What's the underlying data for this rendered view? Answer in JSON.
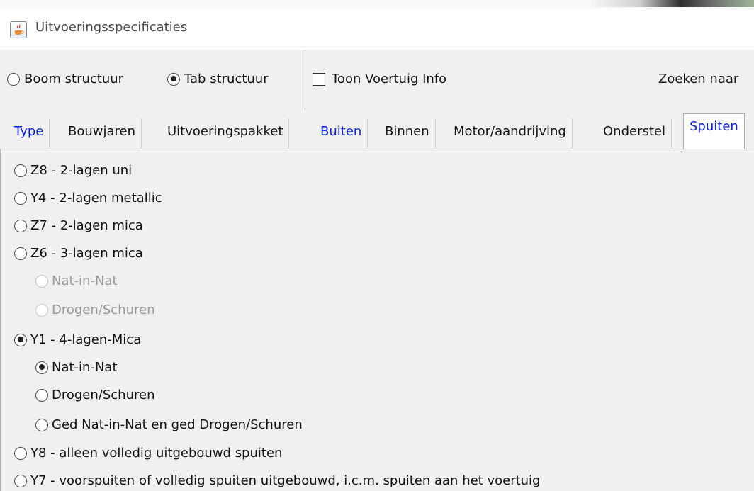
{
  "window": {
    "title": "Uitvoeringsspecificaties",
    "icon": "java-cup-icon"
  },
  "options": {
    "boom_label": "Boom structuur",
    "boom_selected": false,
    "tab_label": "Tab structuur",
    "tab_selected": true,
    "toon_label": "Toon Voertuig Info",
    "toon_checked": false,
    "search_label": "Zoeken naar"
  },
  "tabs": [
    {
      "label": "Type",
      "color": "#0b22d8"
    },
    {
      "label": "Bouwjaren"
    },
    {
      "label": "Uitvoeringspakket"
    },
    {
      "label": "Buiten",
      "color": "#0b22d8"
    },
    {
      "label": "Binnen"
    },
    {
      "label": "Motor/aandrijving"
    },
    {
      "label": "Onderstel"
    },
    {
      "label": "Spuiten",
      "active": true,
      "color": "#0b22d8"
    }
  ],
  "spuiten": {
    "items": [
      {
        "label": "Z8 - 2-lagen uni",
        "selected": false
      },
      {
        "label": "Y4 - 2-lagen metallic",
        "selected": false
      },
      {
        "label": "Z7 - 2-lagen mica",
        "selected": false
      },
      {
        "label": "Z6 - 3-lagen mica",
        "selected": false
      },
      {
        "label": "Nat-in-Nat",
        "selected": false,
        "disabled": true
      },
      {
        "label": "Drogen/Schuren",
        "selected": false,
        "disabled": true
      },
      {
        "label": "Y1 - 4-lagen-Mica",
        "selected": true
      },
      {
        "label": "Nat-in-Nat",
        "selected": true
      },
      {
        "label": "Drogen/Schuren",
        "selected": false
      },
      {
        "label": "Ged Nat-in-Nat en ged Drogen/Schuren",
        "selected": false
      },
      {
        "label": "Y8 - alleen volledig uitgebouwd spuiten",
        "selected": false
      },
      {
        "label": "Y7 - voorspuiten of volledig spuiten uitgebouwd, i.c.m. spuiten aan het voertuig",
        "selected": false
      }
    ]
  }
}
